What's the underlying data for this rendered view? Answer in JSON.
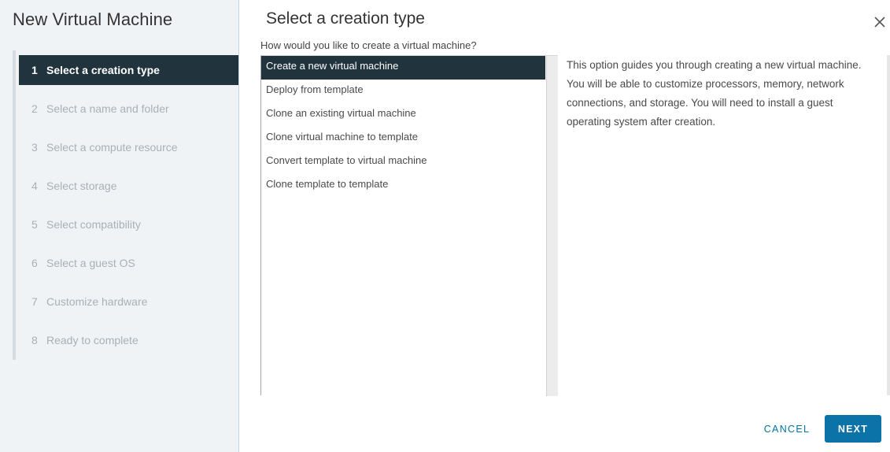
{
  "wizard": {
    "title": "New Virtual Machine"
  },
  "steps": [
    {
      "number": "1",
      "label": "Select a creation type",
      "active": true
    },
    {
      "number": "2",
      "label": "Select a name and folder",
      "active": false
    },
    {
      "number": "3",
      "label": "Select a compute resource",
      "active": false
    },
    {
      "number": "4",
      "label": "Select storage",
      "active": false
    },
    {
      "number": "5",
      "label": "Select compatibility",
      "active": false
    },
    {
      "number": "6",
      "label": "Select a guest OS",
      "active": false
    },
    {
      "number": "7",
      "label": "Customize hardware",
      "active": false
    },
    {
      "number": "8",
      "label": "Ready to complete",
      "active": false
    }
  ],
  "main": {
    "title": "Select a creation type",
    "question": "How would you like to create a virtual machine?",
    "creation_types": [
      {
        "label": "Create a new virtual machine",
        "selected": true
      },
      {
        "label": "Deploy from template",
        "selected": false
      },
      {
        "label": "Clone an existing virtual machine",
        "selected": false
      },
      {
        "label": "Clone virtual machine to template",
        "selected": false
      },
      {
        "label": "Convert template to virtual machine",
        "selected": false
      },
      {
        "label": "Clone template to template",
        "selected": false
      }
    ],
    "description": "This option guides you through creating a new virtual machine. You will be able to customize processors, memory, network connections, and storage. You will need to install a guest operating system after creation."
  },
  "footer": {
    "cancel_label": "CANCEL",
    "next_label": "NEXT"
  },
  "icons": {
    "close": "close-icon"
  },
  "colors": {
    "active_step_bg": "#21333d",
    "primary_button": "#0b73a8",
    "link_button": "#0072a3",
    "left_pane_bg": "#f0f3f6"
  }
}
